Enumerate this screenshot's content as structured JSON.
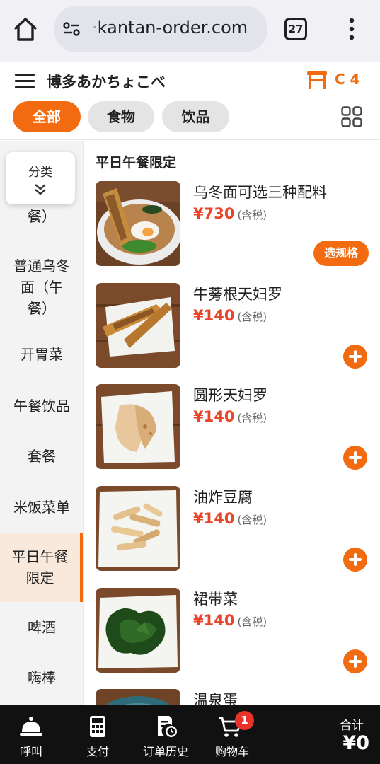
{
  "browser": {
    "url_prefix": "·",
    "url_domain": "kantan-order.com",
    "tab_count": "27"
  },
  "store": {
    "name": "博多あかちょこべ",
    "table_label": "C 4"
  },
  "filters": {
    "all": "全部",
    "food": "食物",
    "drinks": "饮品",
    "selected": "全部"
  },
  "sidebar": {
    "popup_label": "分类",
    "partial_item": "餐）",
    "items": [
      {
        "lines": [
          "普通乌冬",
          "面（午",
          "餐）"
        ]
      },
      {
        "lines": [
          "开胃菜"
        ]
      },
      {
        "lines": [
          "午餐饮品"
        ]
      },
      {
        "lines": [
          "套餐"
        ]
      },
      {
        "lines": [
          "米饭菜单"
        ]
      },
      {
        "lines": [
          "平日午餐",
          "限定"
        ]
      },
      {
        "lines": [
          "啤酒"
        ]
      },
      {
        "lines": [
          "嗨棒"
        ]
      }
    ],
    "active_index": 5
  },
  "section": {
    "title": "平日午餐限定"
  },
  "menu_items": [
    {
      "name": "乌冬面可选三种配料",
      "price": "¥730",
      "tax": "(含税)",
      "action": "选规格"
    },
    {
      "name": "牛蒡根天妇罗",
      "price": "¥140",
      "tax": "(含税)"
    },
    {
      "name": "圆形天妇罗",
      "price": "¥140",
      "tax": "(含税)"
    },
    {
      "name": "油炸豆腐",
      "price": "¥140",
      "tax": "(含税)"
    },
    {
      "name": "裙带菜",
      "price": "¥140",
      "tax": "(含税)"
    },
    {
      "name": "温泉蛋"
    }
  ],
  "bottom_nav": {
    "call": "呼叫",
    "pay": "支付",
    "history": "订单历史",
    "cart": "购物车",
    "cart_count": "1",
    "total_label": "合计",
    "total_value": "¥0"
  },
  "colors": {
    "accent": "#f26b10",
    "price": "#e8452a",
    "badge": "#e8322a"
  }
}
